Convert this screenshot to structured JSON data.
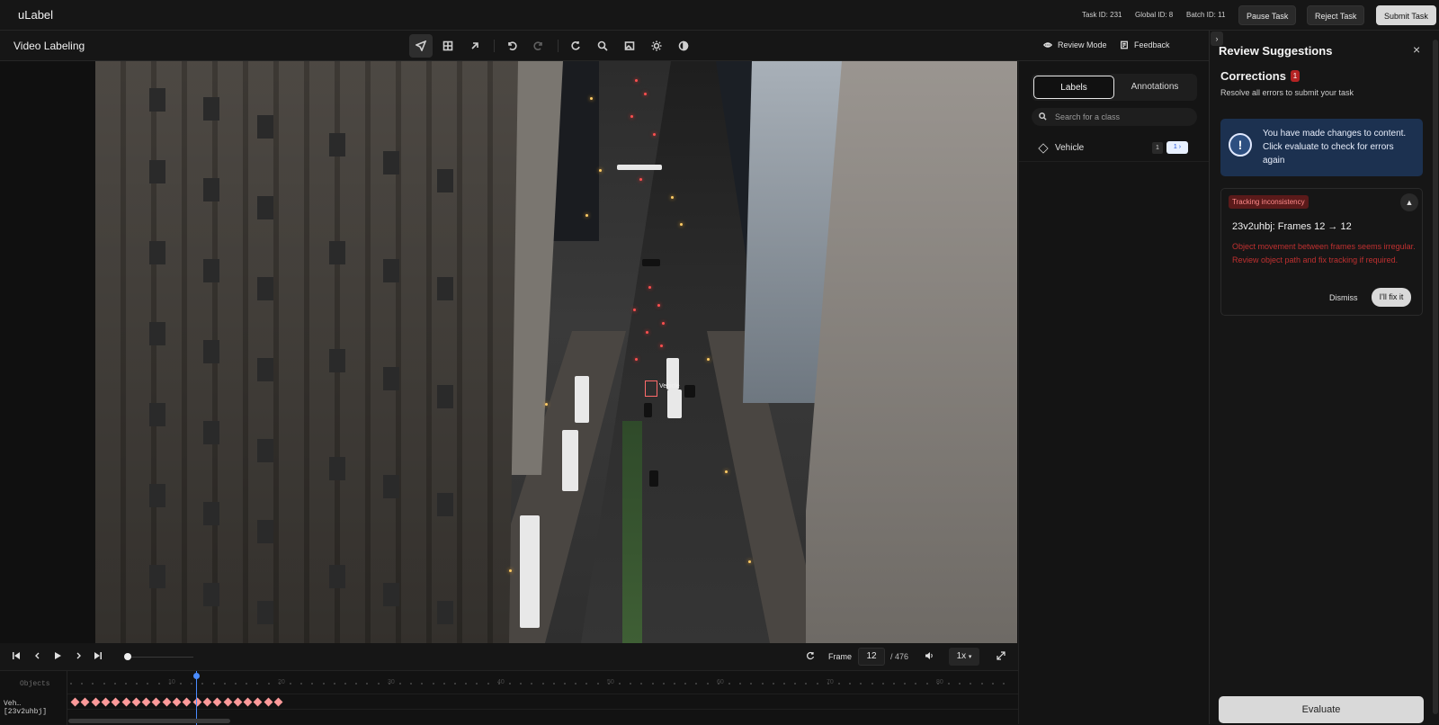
{
  "app": {
    "title": "uLabel"
  },
  "header": {
    "task_id": "Task ID: 231",
    "global_id": "Global ID: 8",
    "batch_id": "Batch ID: 11",
    "pause_label": "Pause Task",
    "reject_label": "Reject Task",
    "submit_label": "Submit Task"
  },
  "toolbar": {
    "title": "Video Labeling",
    "review_mode": "Review Mode",
    "feedback": "Feedback"
  },
  "video": {
    "box_label": "Vehicle"
  },
  "player": {
    "frame_label": "Frame",
    "frame_value": "12",
    "frame_total": "/ 476",
    "speed": "1x"
  },
  "timeline": {
    "objects_label": "Objects",
    "track_label": "Veh… [23v2uhbj]",
    "ticks": [
      "10",
      "20",
      "30",
      "40",
      "50",
      "60",
      "70",
      "80"
    ]
  },
  "labels_panel": {
    "tabs": [
      "Labels",
      "Annotations"
    ],
    "search_placeholder": "Search for a class",
    "classes": [
      {
        "name": "Vehicle",
        "count": "1",
        "tag": "1 ›"
      }
    ]
  },
  "review": {
    "title": "Review Suggestions",
    "corrections_title": "Corrections",
    "corrections_count": "1",
    "corrections_sub": "Resolve all errors to submit your task",
    "info_text": "You have made changes to content. Click evaluate to check for errors again",
    "error": {
      "tag": "Tracking inconsistency",
      "heading": "23v2uhbj: Frames 12 → 12",
      "text": "Object movement between frames seems irregular. Review object path and fix tracking if required.",
      "dismiss": "Dismiss",
      "fix": "I'll fix it"
    },
    "evaluate_label": "Evaluate"
  },
  "colors": {
    "accent": "#4a8cff",
    "error": "#c03030",
    "keyframe": "#ff9a9a"
  }
}
